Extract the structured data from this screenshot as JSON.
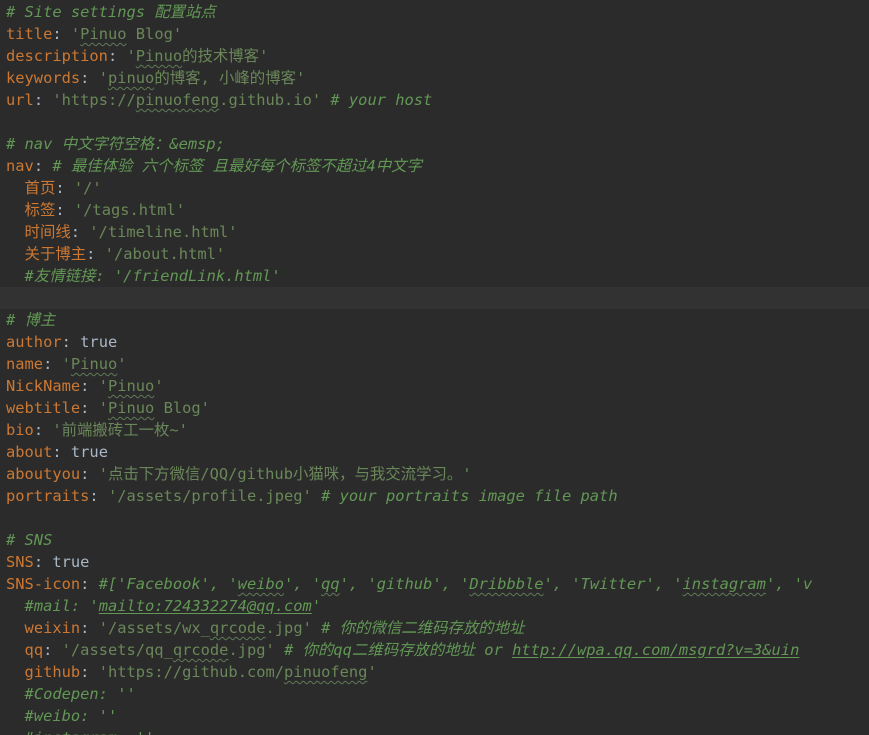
{
  "editor": {
    "lines": [
      {
        "segments": [
          {
            "t": "# Site settings 配置站点",
            "c": "c"
          }
        ]
      },
      {
        "segments": [
          {
            "t": "title",
            "c": "k"
          },
          {
            "t": ": ",
            "c": "p"
          },
          {
            "t": "'",
            "c": "s"
          },
          {
            "t": "Pinuo",
            "c": "s sq"
          },
          {
            "t": " Blog'",
            "c": "s"
          }
        ]
      },
      {
        "segments": [
          {
            "t": "description",
            "c": "k"
          },
          {
            "t": ": ",
            "c": "p"
          },
          {
            "t": "'",
            "c": "s"
          },
          {
            "t": "Pinuo",
            "c": "s sq"
          },
          {
            "t": "的技术博客'",
            "c": "s"
          }
        ]
      },
      {
        "segments": [
          {
            "t": "keywords",
            "c": "k"
          },
          {
            "t": ": ",
            "c": "p"
          },
          {
            "t": "'",
            "c": "s"
          },
          {
            "t": "pinuo",
            "c": "s sq"
          },
          {
            "t": "的博客, 小峰的博客'",
            "c": "s"
          }
        ]
      },
      {
        "segments": [
          {
            "t": "url",
            "c": "k"
          },
          {
            "t": ": ",
            "c": "p"
          },
          {
            "t": "'https://",
            "c": "s"
          },
          {
            "t": "pinuofeng",
            "c": "s sq"
          },
          {
            "t": ".github.io'",
            "c": "s"
          },
          {
            "t": " # your host",
            "c": "c"
          }
        ]
      },
      {
        "segments": []
      },
      {
        "segments": [
          {
            "t": "# nav 中文字符空格：&emsp;",
            "c": "c"
          }
        ]
      },
      {
        "segments": [
          {
            "t": "nav",
            "c": "k"
          },
          {
            "t": ": ",
            "c": "p"
          },
          {
            "t": "# 最佳体验 六个标签 且最好每个标签不超过4中文字",
            "c": "c"
          }
        ]
      },
      {
        "segments": [
          {
            "t": "  ",
            "c": "p"
          },
          {
            "t": "首页",
            "c": "k"
          },
          {
            "t": ": ",
            "c": "p"
          },
          {
            "t": "'/'",
            "c": "s"
          }
        ]
      },
      {
        "segments": [
          {
            "t": "  ",
            "c": "p"
          },
          {
            "t": "标签",
            "c": "k"
          },
          {
            "t": ": ",
            "c": "p"
          },
          {
            "t": "'/tags.html'",
            "c": "s"
          }
        ]
      },
      {
        "segments": [
          {
            "t": "  ",
            "c": "p"
          },
          {
            "t": "时间线",
            "c": "k"
          },
          {
            "t": ": ",
            "c": "p"
          },
          {
            "t": "'/timeline.html'",
            "c": "s"
          }
        ]
      },
      {
        "segments": [
          {
            "t": "  ",
            "c": "p"
          },
          {
            "t": "关于博主",
            "c": "k"
          },
          {
            "t": ": ",
            "c": "p"
          },
          {
            "t": "'/about.html'",
            "c": "s"
          }
        ]
      },
      {
        "segments": [
          {
            "t": "  ",
            "c": "p"
          },
          {
            "t": "#友情链接: '/friendLink.html'",
            "c": "c"
          }
        ]
      },
      {
        "segments": [],
        "current": true
      },
      {
        "segments": [
          {
            "t": "# 博主",
            "c": "c"
          }
        ]
      },
      {
        "segments": [
          {
            "t": "author",
            "c": "k"
          },
          {
            "t": ": ",
            "c": "p"
          },
          {
            "t": "true",
            "c": "v"
          }
        ]
      },
      {
        "segments": [
          {
            "t": "name",
            "c": "k"
          },
          {
            "t": ": ",
            "c": "p"
          },
          {
            "t": "'",
            "c": "s"
          },
          {
            "t": "Pinuo",
            "c": "s sq"
          },
          {
            "t": "'",
            "c": "s"
          }
        ]
      },
      {
        "segments": [
          {
            "t": "NickName",
            "c": "k"
          },
          {
            "t": ": ",
            "c": "p"
          },
          {
            "t": "'",
            "c": "s"
          },
          {
            "t": "Pinuo",
            "c": "s sq"
          },
          {
            "t": "'",
            "c": "s"
          }
        ]
      },
      {
        "segments": [
          {
            "t": "webtitle",
            "c": "k"
          },
          {
            "t": ": ",
            "c": "p"
          },
          {
            "t": "'",
            "c": "s"
          },
          {
            "t": "Pinuo",
            "c": "s sq"
          },
          {
            "t": " Blog'",
            "c": "s"
          }
        ]
      },
      {
        "segments": [
          {
            "t": "bio",
            "c": "k"
          },
          {
            "t": ": ",
            "c": "p"
          },
          {
            "t": "'前端搬砖工一枚~'",
            "c": "s"
          }
        ]
      },
      {
        "segments": [
          {
            "t": "about",
            "c": "k"
          },
          {
            "t": ": ",
            "c": "p"
          },
          {
            "t": "true",
            "c": "v"
          }
        ]
      },
      {
        "segments": [
          {
            "t": "aboutyou",
            "c": "k"
          },
          {
            "t": ": ",
            "c": "p"
          },
          {
            "t": "'点击下方微信/QQ/github小猫咪，与我交流学习。'",
            "c": "s"
          }
        ]
      },
      {
        "segments": [
          {
            "t": "portraits",
            "c": "k"
          },
          {
            "t": ": ",
            "c": "p"
          },
          {
            "t": "'/assets/profile.jpeg'",
            "c": "s"
          },
          {
            "t": " # your portraits image file path",
            "c": "c"
          }
        ]
      },
      {
        "segments": []
      },
      {
        "segments": [
          {
            "t": "# SNS",
            "c": "c"
          }
        ]
      },
      {
        "segments": [
          {
            "t": "SNS",
            "c": "k"
          },
          {
            "t": ": ",
            "c": "p"
          },
          {
            "t": "true",
            "c": "v"
          }
        ]
      },
      {
        "segments": [
          {
            "t": "SNS-icon",
            "c": "k"
          },
          {
            "t": ": ",
            "c": "p"
          },
          {
            "t": "#['Facebook', '",
            "c": "c"
          },
          {
            "t": "weibo",
            "c": "c sq"
          },
          {
            "t": "', '",
            "c": "c"
          },
          {
            "t": "qq",
            "c": "c sq"
          },
          {
            "t": "', 'github', '",
            "c": "c"
          },
          {
            "t": "Dribbble",
            "c": "c sq"
          },
          {
            "t": "', 'Twitter', '",
            "c": "c"
          },
          {
            "t": "instagram",
            "c": "c sq"
          },
          {
            "t": "', 'v",
            "c": "c"
          }
        ]
      },
      {
        "segments": [
          {
            "t": "  ",
            "c": "p"
          },
          {
            "t": "#mail: '",
            "c": "c"
          },
          {
            "t": "mailto:724332274@qq.com",
            "c": "c lnk"
          },
          {
            "t": "'",
            "c": "c"
          }
        ]
      },
      {
        "segments": [
          {
            "t": "  ",
            "c": "p"
          },
          {
            "t": "weixin",
            "c": "k"
          },
          {
            "t": ": ",
            "c": "p"
          },
          {
            "t": "'/assets/wx_",
            "c": "s"
          },
          {
            "t": "qrcode",
            "c": "s sq"
          },
          {
            "t": ".jpg'",
            "c": "s"
          },
          {
            "t": " # 你的微信二维码存放的地址",
            "c": "c"
          }
        ]
      },
      {
        "segments": [
          {
            "t": "  ",
            "c": "p"
          },
          {
            "t": "qq",
            "c": "k"
          },
          {
            "t": ": ",
            "c": "p"
          },
          {
            "t": "'/assets/qq_",
            "c": "s"
          },
          {
            "t": "qrcode",
            "c": "s sq"
          },
          {
            "t": ".jpg'",
            "c": "s"
          },
          {
            "t": " # 你的qq二维码存放的地址 or ",
            "c": "c"
          },
          {
            "t": "http://wpa.qq.com/msgrd?v=3&uin",
            "c": "c lnk"
          }
        ]
      },
      {
        "segments": [
          {
            "t": "  ",
            "c": "p"
          },
          {
            "t": "github",
            "c": "k"
          },
          {
            "t": ": ",
            "c": "p"
          },
          {
            "t": "'https://github.com/",
            "c": "s"
          },
          {
            "t": "pinuofeng",
            "c": "s sq"
          },
          {
            "t": "'",
            "c": "s"
          }
        ]
      },
      {
        "segments": [
          {
            "t": "  ",
            "c": "p"
          },
          {
            "t": "#Codepen: ''",
            "c": "c"
          }
        ]
      },
      {
        "segments": [
          {
            "t": "  ",
            "c": "p"
          },
          {
            "t": "#weibo: ''",
            "c": "c"
          }
        ]
      },
      {
        "segments": [
          {
            "t": "  ",
            "c": "p"
          },
          {
            "t": "#instagram: ''",
            "c": "c"
          }
        ]
      }
    ]
  },
  "colors": {
    "background": "#2b2b2b",
    "current_line": "#323232",
    "key": "#cc7832",
    "string": "#6a8759",
    "comment": "#629755",
    "plain": "#a9b7c6"
  }
}
